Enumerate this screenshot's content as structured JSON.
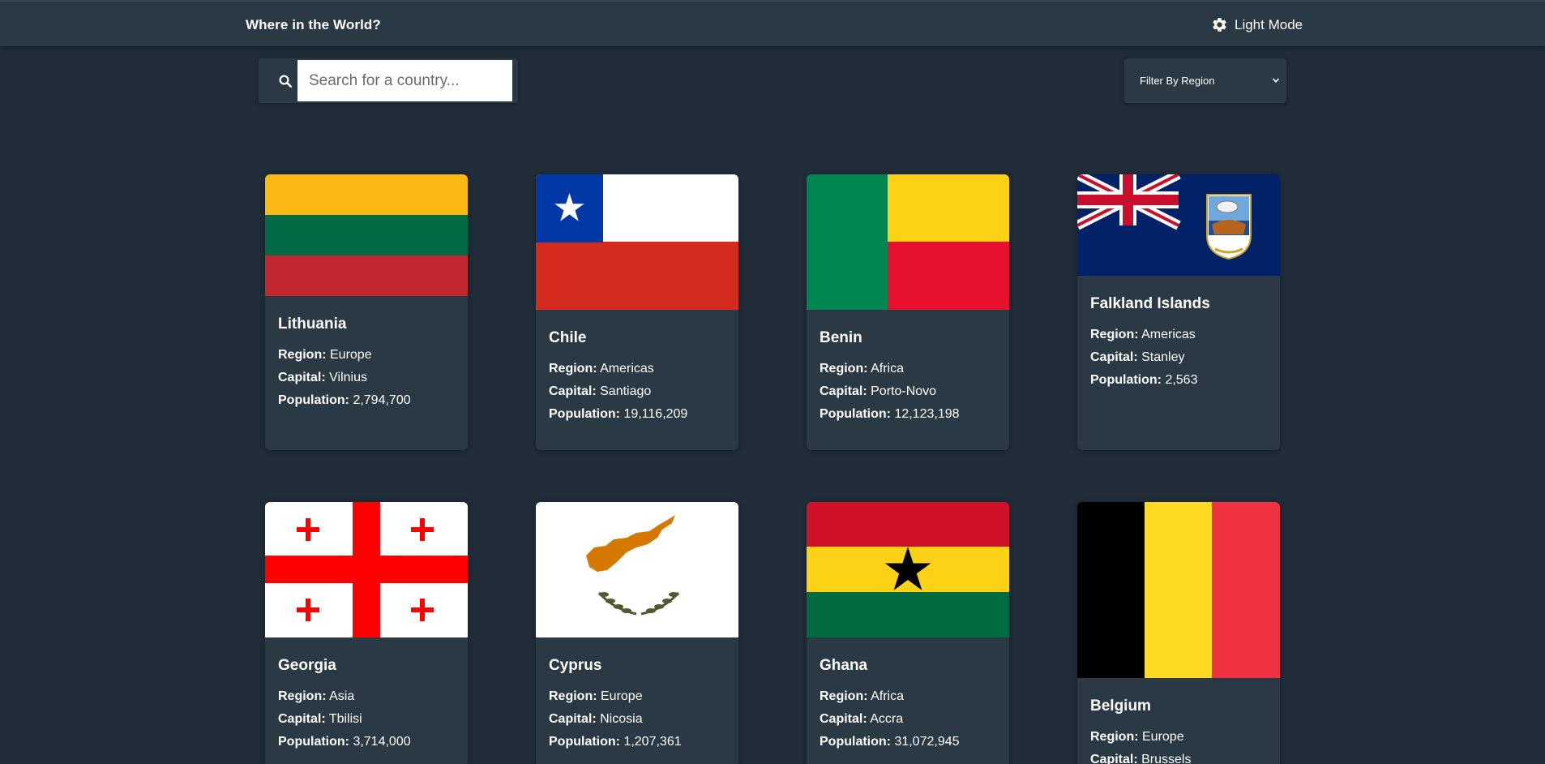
{
  "header": {
    "title": "Where in the World?",
    "mode_label": "Light Mode"
  },
  "search": {
    "placeholder": "Search for a country...",
    "value": ""
  },
  "filter": {
    "label": "Filter By Region"
  },
  "labels": {
    "region": "Region:",
    "capital": "Capital:",
    "population": "Population:"
  },
  "countries": [
    {
      "name": "Lithuania",
      "region": "Europe",
      "capital": "Vilnius",
      "population": "2,794,700"
    },
    {
      "name": "Chile",
      "region": "Americas",
      "capital": "Santiago",
      "population": "19,116,209"
    },
    {
      "name": "Benin",
      "region": "Africa",
      "capital": "Porto-Novo",
      "population": "12,123,198"
    },
    {
      "name": "Falkland Islands",
      "region": "Americas",
      "capital": "Stanley",
      "population": "2,563"
    },
    {
      "name": "Georgia",
      "region": "Asia",
      "capital": "Tbilisi",
      "population": "3,714,000"
    },
    {
      "name": "Cyprus",
      "region": "Europe",
      "capital": "Nicosia",
      "population": "1,207,361"
    },
    {
      "name": "Ghana",
      "region": "Africa",
      "capital": "Accra",
      "population": "31,072,945"
    },
    {
      "name": "Belgium",
      "region": "Europe",
      "capital": "Brussels",
      "population": ""
    }
  ],
  "colors": {
    "background": "#202c37",
    "element": "#2b3945",
    "text": "#ffffff"
  }
}
